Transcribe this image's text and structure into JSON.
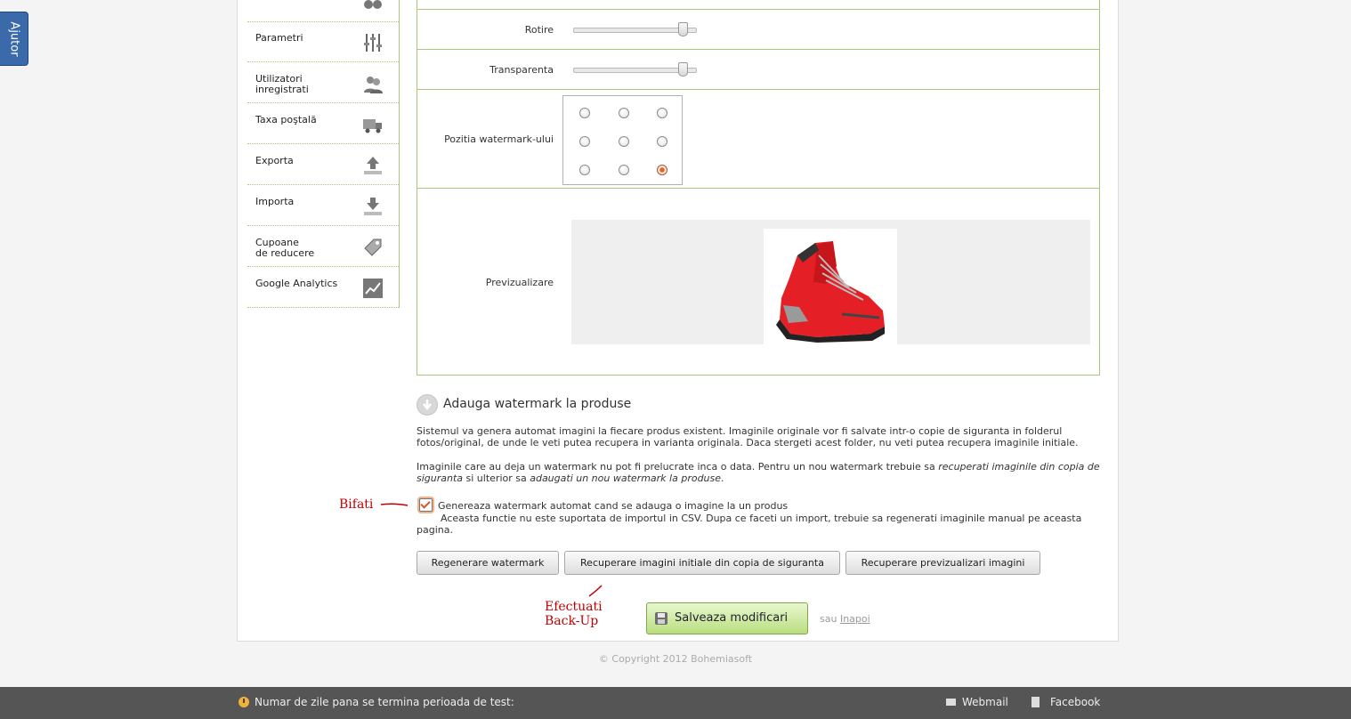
{
  "help_tab": {
    "label": "Ajutor"
  },
  "sidebar": {
    "items": [
      {
        "label": "Parametri",
        "icon": "sliders-icon"
      },
      {
        "label": "Utilizatori inregistrati",
        "line1": "Utilizatori",
        "line2": "inregistrati",
        "icon": "users-icon"
      },
      {
        "label": "Taxa poştală",
        "icon": "truck-icon"
      },
      {
        "label": "Exporta",
        "icon": "upload-icon"
      },
      {
        "label": "Importa",
        "icon": "download-icon"
      },
      {
        "label": "Cupoane de reducere",
        "line1": "Cupoane",
        "line2": "de reducere",
        "icon": "tag-icon"
      },
      {
        "label": "Google Analytics",
        "icon": "analytics-icon"
      }
    ]
  },
  "settings": {
    "rotation": {
      "label": "Rotire",
      "value_fraction": 0.93
    },
    "transparency": {
      "label": "Transparenta",
      "value_fraction": 0.93
    },
    "position": {
      "label": "Pozitia watermark-ului",
      "selected_row": 3,
      "selected_col": 3
    },
    "preview": {
      "label": "Previzualizare"
    }
  },
  "watermark_section": {
    "title": "Adauga watermark la produse",
    "para1": "Sistemul va genera automat imagini la fiecare produs existent. Imaginile originale vor fi salvate intr-o copie de siguranta in folderul fotos/original, de unde le veti putea recupera in varianta originala. Daca stergeti acest folder, nu veti putea recupera imaginile initiale.",
    "para2_a": "Imaginile care au deja un watermark nu pot fi prelucrate inca o data. Pentru un nou watermark trebuie sa ",
    "para2_b": "recuperati imaginile din copia de siguranta",
    "para2_c": " si ulterior sa ",
    "para2_d": "adaugati un nou watermark la produse",
    "para2_e": ".",
    "checkbox_label": "Genereaza watermark automat cand se adauga o imagine la un produs",
    "checkbox_checked": true,
    "checkbox_note": "Aceasta functie nu este suportata de importul in CSV. Dupa ce faceti un import, trebuie sa regenerati imaginile manual pe aceasta pagina.",
    "buttons": {
      "regen": "Regenerare watermark",
      "recover": "Recuperare imagini initiale din copia de siguranta",
      "previews": "Recuperare previzualizari imagini"
    }
  },
  "actions": {
    "save": "Salveaza modificari",
    "or": "sau",
    "back": "Inapoi"
  },
  "annotations": {
    "check": "Bifati",
    "backup_line1": "Efectuati",
    "backup_line2": "Back-Up"
  },
  "copyright": "© Copyright 2012 Bohemiasoft",
  "footer": {
    "trial": "Numar de zile pana se termina perioada de test:",
    "webmail": "Webmail",
    "facebook": "Facebook"
  },
  "colors": {
    "accent_green": "#a9c97a",
    "annotation_red": "#c00000",
    "radio_selected": "#e7632d",
    "footer_bg": "#555555"
  }
}
